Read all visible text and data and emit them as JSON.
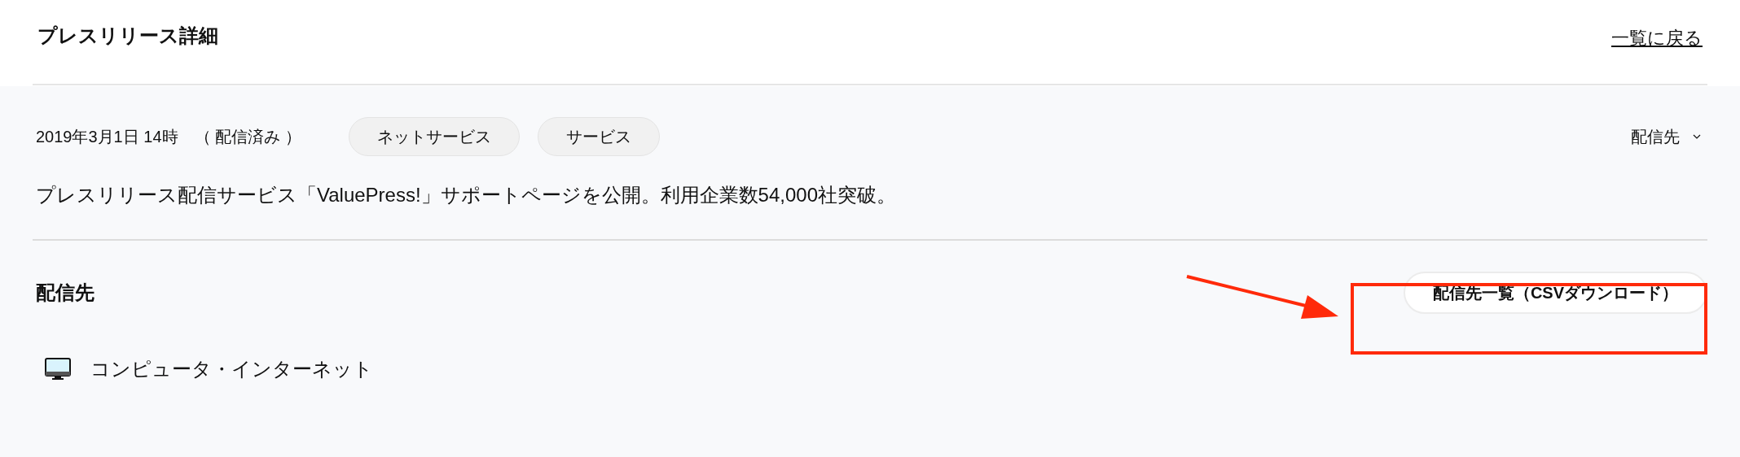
{
  "header": {
    "title": "プレスリリース詳細",
    "back_link": "一覧に戻る"
  },
  "release": {
    "datetime": "2019年3月1日 14時",
    "status": "（ 配信済み ）",
    "tags": [
      "ネットサービス",
      "サービス"
    ],
    "distribution_dropdown": "配信先",
    "headline": "プレスリリース配信サービス「ValuePress!」サポートページを公開。利用企業数54,000社突破。"
  },
  "distribution": {
    "heading": "配信先",
    "csv_button": "配信先一覧（CSVダウンロード）",
    "categories": [
      "コンピュータ・インターネット"
    ]
  }
}
